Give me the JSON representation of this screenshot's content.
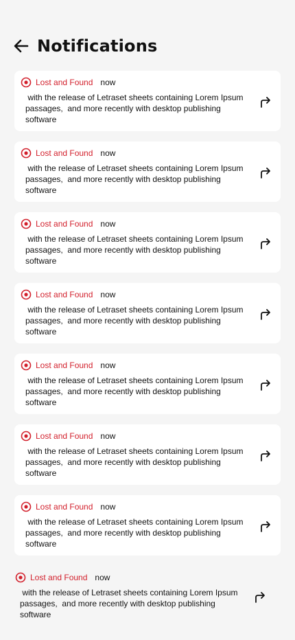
{
  "header": {
    "title": "Notifications",
    "back_icon": "arrow-left-icon"
  },
  "colors": {
    "accent": "#d21f2b",
    "background": "#f5f5f5",
    "card": "#ffffff"
  },
  "notifications": [
    {
      "source": "Lost and Found",
      "time": "now",
      "message": " with the release of Letraset sheets containing Lorem Ipsum passages,  and more recently with desktop publishing software"
    },
    {
      "source": "Lost and Found",
      "time": "now",
      "message": " with the release of Letraset sheets containing Lorem Ipsum passages,  and more recently with desktop publishing software"
    },
    {
      "source": "Lost and Found",
      "time": "now",
      "message": " with the release of Letraset sheets containing Lorem Ipsum passages,  and more recently with desktop publishing software"
    },
    {
      "source": "Lost and Found",
      "time": "now",
      "message": " with the release of Letraset sheets containing Lorem Ipsum passages,  and more recently with desktop publishing software"
    },
    {
      "source": "Lost and Found",
      "time": "now",
      "message": " with the release of Letraset sheets containing Lorem Ipsum passages,  and more recently with desktop publishing software"
    },
    {
      "source": "Lost and Found",
      "time": "now",
      "message": " with the release of Letraset sheets containing Lorem Ipsum passages,  and more recently with desktop publishing software"
    },
    {
      "source": "Lost and Found",
      "time": "now",
      "message": " with the release of Letraset sheets containing Lorem Ipsum passages,  and more recently with desktop publishing software"
    },
    {
      "source": "Lost and Found",
      "time": "now",
      "message": " with the release of Letraset sheets containing Lorem Ipsum passages,  and more recently with desktop publishing software"
    }
  ]
}
